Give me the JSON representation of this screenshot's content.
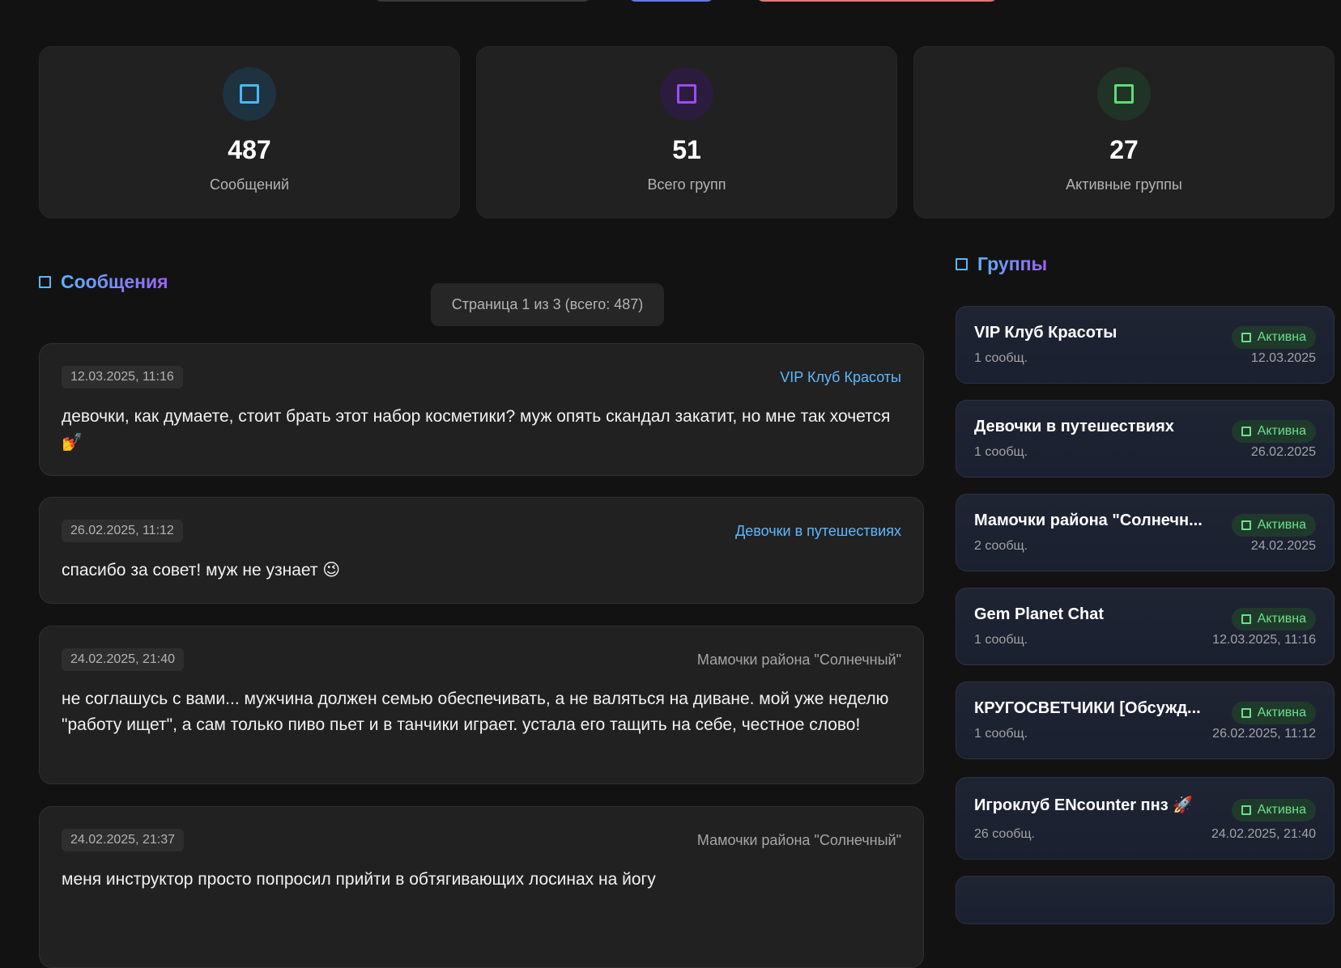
{
  "colors": {
    "background": "#121212",
    "card": "#212121",
    "accent_blue": "#5cb8ff",
    "accent_purple": "#9a63f2",
    "accent_green": "#6be08a"
  },
  "stats": [
    {
      "icon": "square-icon-blue",
      "value": "487",
      "label": "Сообщений"
    },
    {
      "icon": "square-icon-purple",
      "value": "51",
      "label": "Всего групп"
    },
    {
      "icon": "square-icon-green",
      "value": "27",
      "label": "Активные группы"
    }
  ],
  "messages_section": {
    "title": "Сообщения",
    "pagination": "Страница 1 из 3 (всего: 487)",
    "items": [
      {
        "date": "12.03.2025, 11:16",
        "group": "VIP Клуб Красоты",
        "text": "девочки, как думаете, стоит брать этот набор косметики? муж опять скандал закатит, но мне так хочется💅"
      },
      {
        "date": "26.02.2025, 11:12",
        "group": "Девочки в путешествиях",
        "text": "спасибо за совет! муж не узнает 😉"
      },
      {
        "date": "24.02.2025, 21:40",
        "group": "Мамочки района \"Солнечный\"",
        "text": "не соглашусь с вами... мужчина должен семью обеспечивать, а не валяться на диване. мой уже неделю \"работу ищет\", а сам только пиво пьет и в танчики играет. устала его тащить на себе, честное слово!"
      },
      {
        "date": "24.02.2025, 21:37",
        "group": "Мамочки района \"Солнечный\"",
        "text": "меня инструктор просто попросил прийти в обтягивающих лосинах на йогу"
      }
    ]
  },
  "groups_section": {
    "title": "Группы",
    "badge_label": "Активна",
    "items": [
      {
        "name": "VIP Клуб Красоты",
        "count": "1 сообщ.",
        "date": "12.03.2025"
      },
      {
        "name": "Девочки в путешествиях",
        "count": "1 сообщ.",
        "date": "26.02.2025"
      },
      {
        "name": "Мамочки района \"Солнечн...",
        "count": "2 сообщ.",
        "date": "24.02.2025"
      },
      {
        "name": "Gem Planet Chat",
        "count": "1 сообщ.",
        "date": "12.03.2025, 11:16"
      },
      {
        "name": "КРУГОСВЕТЧИКИ [Обсужд...",
        "count": "1 сообщ.",
        "date": "26.02.2025, 11:12"
      },
      {
        "name": "Игроклуб ENcounter пнз 🚀",
        "count": "26 сообщ.",
        "date": "24.02.2025, 21:40"
      }
    ]
  }
}
